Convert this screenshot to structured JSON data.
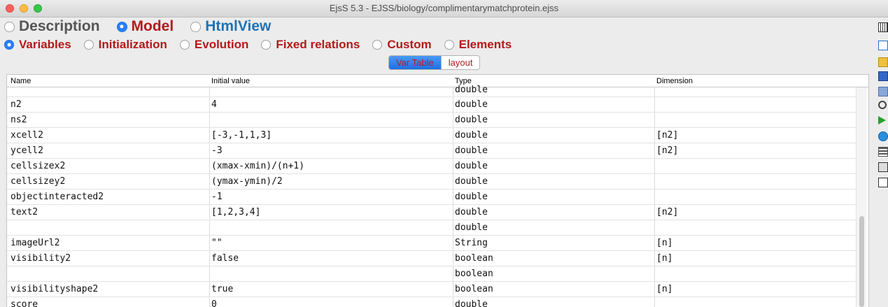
{
  "window": {
    "title": "EjsS 5.3 - EJSS/biology/complimentarymatchprotein.ejss"
  },
  "main_tabs": [
    {
      "label": "Description",
      "selected": false,
      "color": "#555555"
    },
    {
      "label": "Model",
      "selected": true,
      "color": "#b41a1a"
    },
    {
      "label": "HtmlView",
      "selected": false,
      "color": "#1f73b7"
    }
  ],
  "model_tabs": [
    {
      "label": "Variables",
      "selected": true
    },
    {
      "label": "Initialization",
      "selected": false
    },
    {
      "label": "Evolution",
      "selected": false
    },
    {
      "label": "Fixed relations",
      "selected": false
    },
    {
      "label": "Custom",
      "selected": false
    },
    {
      "label": "Elements",
      "selected": false
    }
  ],
  "view_switch": {
    "var_table": "Var Table",
    "layout": "layout",
    "selected": "Var Table"
  },
  "table": {
    "headers": [
      "Name",
      "Initial value",
      "Type",
      "Dimension"
    ],
    "partial_top_row": {
      "name": "",
      "value": "",
      "type": "double",
      "dim": ""
    },
    "rows": [
      {
        "name": "n2",
        "value": "4",
        "type": "double",
        "dim": ""
      },
      {
        "name": "ns2",
        "value": "",
        "type": "double",
        "dim": ""
      },
      {
        "name": "xcell2",
        "value": "[-3,-1,1,3]",
        "type": "double",
        "dim": "[n2]"
      },
      {
        "name": "ycell2",
        "value": "-3",
        "type": "double",
        "dim": "[n2]"
      },
      {
        "name": "cellsizex2",
        "value": "(xmax-xmin)/(n+1)",
        "type": "double",
        "dim": ""
      },
      {
        "name": "cellsizey2",
        "value": "(ymax-ymin)/2",
        "type": "double",
        "dim": ""
      },
      {
        "name": "objectinteracted2",
        "value": "-1",
        "type": "double",
        "dim": ""
      },
      {
        "name": "text2",
        "value": "[1,2,3,4]",
        "type": "double",
        "dim": "[n2]"
      },
      {
        "name": "",
        "value": "",
        "type": "double",
        "dim": ""
      },
      {
        "name": "imageUrl2",
        "value": "\"\"",
        "type": "String",
        "dim": "[n]"
      },
      {
        "name": "visibility2",
        "value": "false",
        "type": "boolean",
        "dim": "[n]"
      },
      {
        "name": "",
        "value": "",
        "type": "boolean",
        "dim": ""
      },
      {
        "name": "visibilityshape2",
        "value": "true",
        "type": "boolean",
        "dim": "[n]"
      },
      {
        "name": "score",
        "value": "0",
        "type": "double",
        "dim": ""
      }
    ]
  },
  "toolbar_icons": [
    "table-icon",
    "new-file-icon",
    "open-folder-icon",
    "save-icon",
    "save-as-icon",
    "search-icon",
    "run-icon",
    "web-icon",
    "layers-icon",
    "edit-icon",
    "info-icon"
  ],
  "colors": {
    "accent": "#2b7ff6",
    "model_red": "#b41a1a",
    "selection": "#0a46c8"
  }
}
